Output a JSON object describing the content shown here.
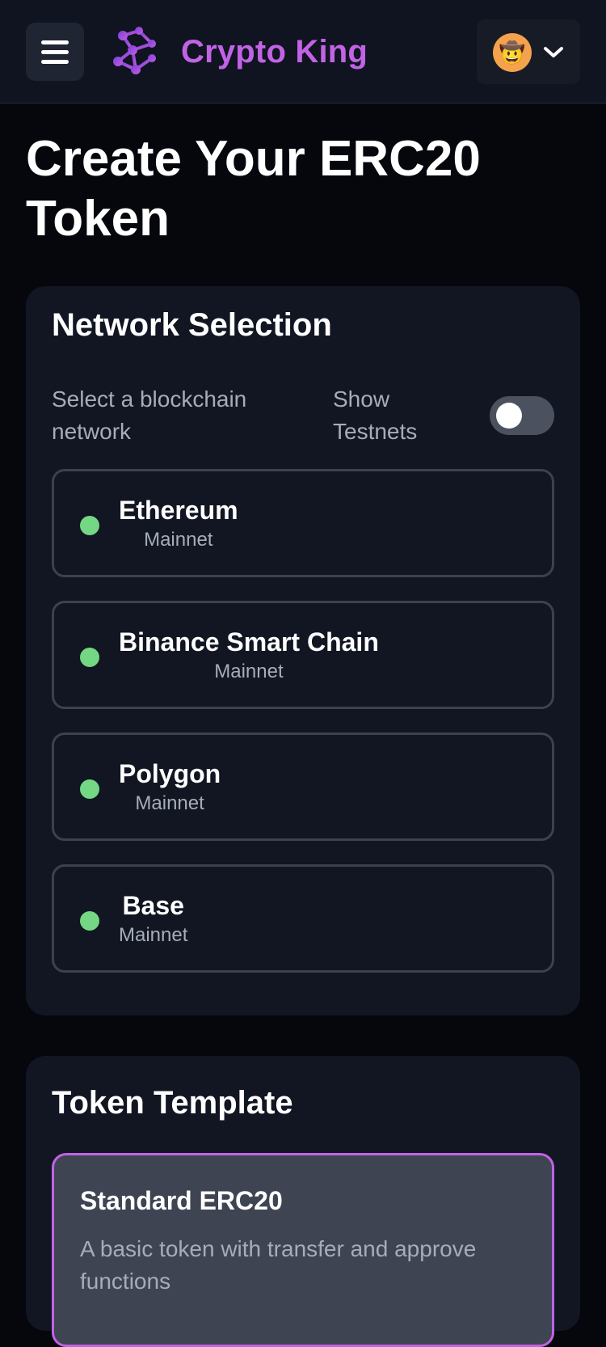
{
  "header": {
    "brand": "Crypto King",
    "menu_icon": "hamburger-menu-icon",
    "logo_icon": "molecule-logo-icon",
    "avatar_emoji": "🤠",
    "chevron_icon": "chevron-down-icon",
    "brand_color": "#c263e6"
  },
  "page": {
    "title": "Create Your ERC20 Token"
  },
  "network_selection": {
    "title": "Network Selection",
    "subtitle": "Select a blockchain network",
    "show_testnets_label": "Show Testnets",
    "show_testnets_enabled": false,
    "networks": [
      {
        "name": "Ethereum",
        "type": "Mainnet",
        "status_color": "#74d783"
      },
      {
        "name": "Binance Smart Chain",
        "type": "Mainnet",
        "status_color": "#74d783"
      },
      {
        "name": "Polygon",
        "type": "Mainnet",
        "status_color": "#74d783"
      },
      {
        "name": "Base",
        "type": "Mainnet",
        "status_color": "#74d783"
      }
    ]
  },
  "token_template": {
    "title": "Token Template",
    "templates": [
      {
        "name": "Standard ERC20",
        "description": "A basic token with transfer and approve functions",
        "selected": true
      }
    ],
    "selected_border_color": "#c163e5"
  }
}
